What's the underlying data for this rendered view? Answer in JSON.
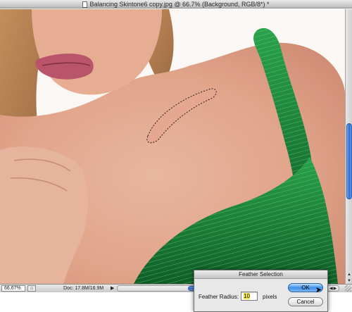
{
  "window": {
    "title": "Balancing Skintone6 copy.jpg @ 66.7% (Background, RGB/8*) *"
  },
  "status": {
    "zoom": "66.67%",
    "doc_size": "Doc: 17.8M/16.9M"
  },
  "dialog": {
    "title": "Feather Selection",
    "radius_label": "Feather Radius:",
    "radius_value": "10",
    "units": "pixels",
    "ok_label": "OK",
    "cancel_label": "Cancel"
  },
  "colors": {
    "dress": "#1f8a3a",
    "skin": "#e8b09a",
    "accent": "#2b6bd1"
  },
  "icons": {
    "document": "doc-icon",
    "status_menu": "status-menu-icon",
    "cursor": "arrow-cursor-icon"
  }
}
